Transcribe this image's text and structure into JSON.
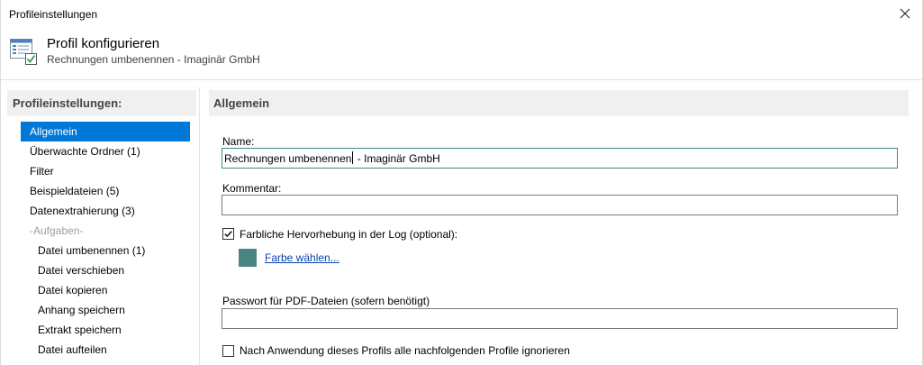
{
  "window": {
    "title": "Profileinstellungen"
  },
  "header": {
    "heading": "Profil konfigurieren",
    "subheading": "Rechnungen umbenennen - Imaginär GmbH"
  },
  "sidebar": {
    "heading": "Profileinstellungen:",
    "items": [
      {
        "label": "Allgemein"
      },
      {
        "label": "Überwachte Ordner (1)"
      },
      {
        "label": "Filter"
      },
      {
        "label": "Beispieldateien (5)"
      },
      {
        "label": "Datenextrahierung (3)"
      },
      {
        "label": "-Aufgaben-"
      },
      {
        "label": "Datei umbenennen (1)"
      },
      {
        "label": "Datei verschieben"
      },
      {
        "label": "Datei kopieren"
      },
      {
        "label": "Anhang speichern"
      },
      {
        "label": "Extrakt speichern"
      },
      {
        "label": "Datei aufteilen"
      }
    ],
    "selected_index": 0
  },
  "content": {
    "heading": "Allgemein",
    "name_label": "Name:",
    "name_before_caret": "Rechnungen umbenennen",
    "name_after_caret": " - Imaginär GmbH",
    "comment_label": "Kommentar:",
    "comment_value": "",
    "highlight_label": "Farbliche Hervorhebung in der Log (optional):",
    "highlight_checked": true,
    "color_link": "Farbe wählen...",
    "password_label": "Passwort für PDF-Dateien (sofern benötigt)",
    "password_value": "",
    "ignore_label": "Nach Anwendung dieses Profils alle nachfolgenden Profile ignorieren",
    "ignore_checked": false
  },
  "colors": {
    "selection": "#0078d7",
    "highlight_swatch": "#4a8584",
    "link": "#0645ad",
    "focus_border": "#3c8a86"
  }
}
